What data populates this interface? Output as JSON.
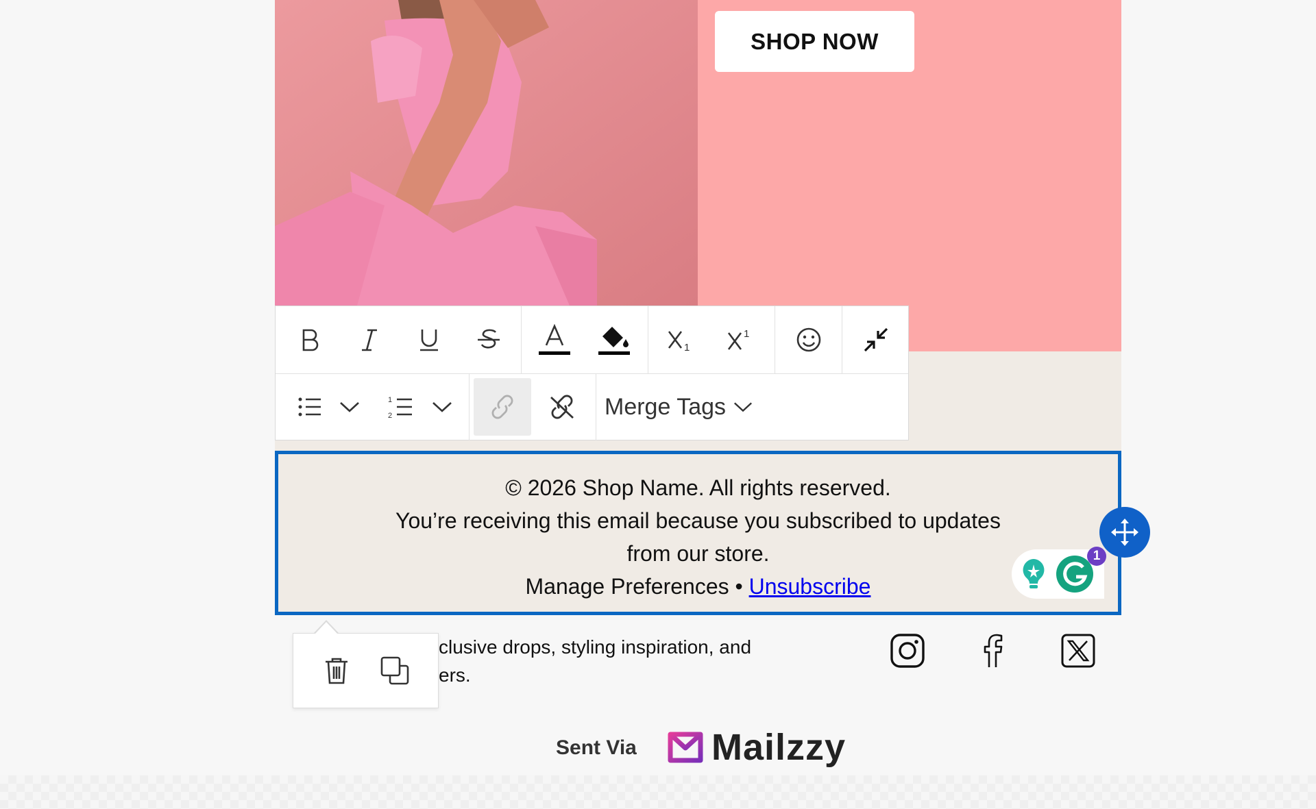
{
  "hero": {
    "image_alt": "Woman in pink outfit",
    "cta_label": "SHOP NOW"
  },
  "toolbar": {
    "row1": [
      "bold",
      "italic",
      "underline",
      "strikethrough",
      "text-color",
      "background-color",
      "subscript",
      "superscript",
      "emoji",
      "collapse"
    ],
    "row2": [
      "bullet-list",
      "bullet-list-options",
      "numbered-list",
      "numbered-list-options",
      "link",
      "unlink"
    ],
    "merge_tags_label": "Merge Tags"
  },
  "footer": {
    "copyright": "© 2026 Shop Name. All rights reserved.",
    "reason_line1": "You’re receiving this email because you subscribed to updates",
    "reason_line2": "from our store.",
    "manage_prefs": "Manage Preferences",
    "separator": " • ",
    "unsubscribe": "Unsubscribe"
  },
  "grammarly": {
    "count": "1"
  },
  "below": {
    "blurb_line1": "clusive drops, styling inspiration, and",
    "blurb_line2": "ers."
  },
  "social": [
    "instagram-icon",
    "facebook-icon",
    "x-icon"
  ],
  "branding": {
    "sent_via": "Sent Via",
    "brand": "Mailzzy"
  },
  "colors": {
    "selection": "#0b67c2",
    "hero_bg": "#fda8a8",
    "footer_bg": "#f0ebe5",
    "link": "#0000ee",
    "brand_magenta": "#c02fa6"
  }
}
